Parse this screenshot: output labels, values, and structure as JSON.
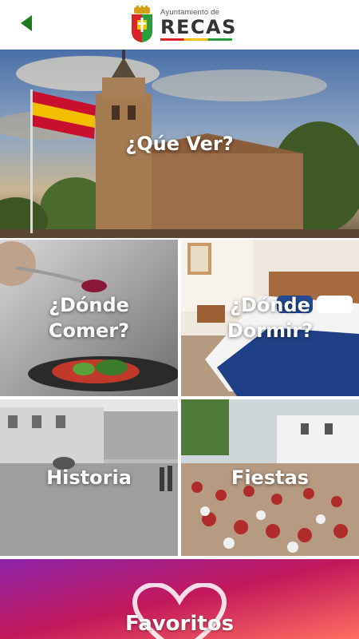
{
  "header": {
    "back_icon": "back-arrow-icon",
    "logo_small": "Ayuntamiento de",
    "logo_big": "RECAS",
    "accent_color": "#1e7a1e"
  },
  "tiles": [
    {
      "id": "que-ver",
      "label": "¿Qúe Ver?"
    },
    {
      "id": "comer",
      "label": "¿Dónde\nComer?"
    },
    {
      "id": "dormir",
      "label": "¿Dónde\nDormir?"
    },
    {
      "id": "historia",
      "label": "Historia"
    },
    {
      "id": "fiestas",
      "label": "Fiestas"
    }
  ],
  "favoritos": {
    "label": "Favoritos",
    "icon": "heart-outline-icon",
    "gradient_colors": [
      "#8e24aa",
      "#c2185b",
      "#ff6f61"
    ]
  }
}
